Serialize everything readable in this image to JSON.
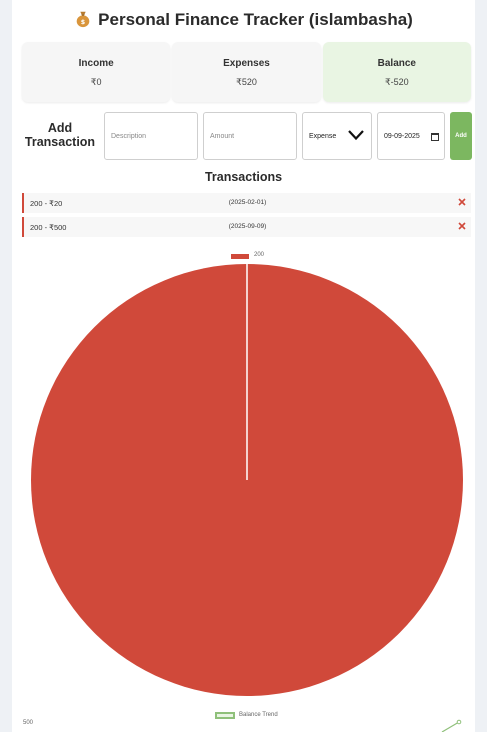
{
  "header": {
    "title": "Personal Finance Tracker (islambasha)",
    "emoji_icon": "money-bag-icon"
  },
  "summary": {
    "income": {
      "label": "Income",
      "value": "₹0"
    },
    "expenses": {
      "label": "Expenses",
      "value": "₹520"
    },
    "balance": {
      "label": "Balance",
      "value": "₹-520"
    }
  },
  "form": {
    "label_line1": "Add",
    "label_line2": "Transaction",
    "description_placeholder": "Description",
    "amount_placeholder": "Amount",
    "type_selected": "Expense",
    "date_value": "09-09-2025",
    "add_label": "Add"
  },
  "transactions": {
    "title": "Transactions",
    "items": [
      {
        "description": "200 - ₹20",
        "date": "(2025-02-01)"
      },
      {
        "description": "200 - ₹500",
        "date": "(2025-09-09)"
      }
    ]
  },
  "colors": {
    "expense": "#d0493a",
    "accent": "#7cb760",
    "balance_card": "#e9f5e3"
  },
  "chart_data": [
    {
      "type": "pie",
      "labels": [
        "200"
      ],
      "values": [
        520
      ],
      "legend": [
        "200"
      ],
      "legend_position": "top"
    },
    {
      "type": "line",
      "series": [
        {
          "name": "Balance Trend",
          "values": []
        }
      ],
      "visible_tick_labels": [
        "500"
      ],
      "legend_position": "top"
    }
  ]
}
